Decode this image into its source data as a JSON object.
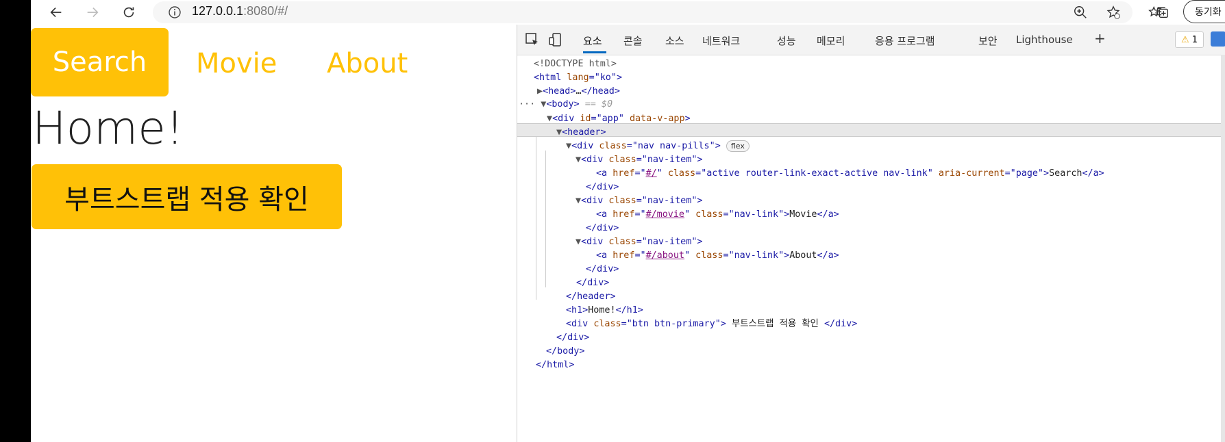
{
  "browser": {
    "url_host": "127.0.0.1",
    "url_rest": ":8080/#/",
    "sync_label": "동기화"
  },
  "page": {
    "nav": [
      {
        "label": "Search"
      },
      {
        "label": "Movie"
      },
      {
        "label": "About"
      }
    ],
    "heading": "Home!",
    "check_button": "부트스트랩 적용 확인"
  },
  "devtools": {
    "tabs": [
      "요소",
      "콘솔",
      "소스",
      "네트워크",
      "성능",
      "메모리",
      "응용 프로그램",
      "보안",
      "Lighthouse"
    ],
    "add_tab": "+",
    "warning_count": "1",
    "dom": {
      "doctype": "<!DOCTYPE html>",
      "html_lang": "ko",
      "head_collapsed": "…",
      "body_marker": "== $0",
      "app_id": "app",
      "app_attr": "data-v-app",
      "nav_class": "nav nav-pills",
      "flex": "flex",
      "item_class": "nav-item",
      "links": [
        {
          "href": "#/",
          "class": "active router-link-exact-active nav-link",
          "extra_attr": "aria-current",
          "extra_val": "page",
          "text": "Search"
        },
        {
          "href": "#/movie",
          "class": "nav-link",
          "text": "Movie"
        },
        {
          "href": "#/about",
          "class": "nav-link",
          "text": "About"
        }
      ],
      "h1_text": "Home!",
      "btn_class": "btn btn-primary",
      "btn_text": " 부트스트랩 적용 확인 "
    }
  }
}
